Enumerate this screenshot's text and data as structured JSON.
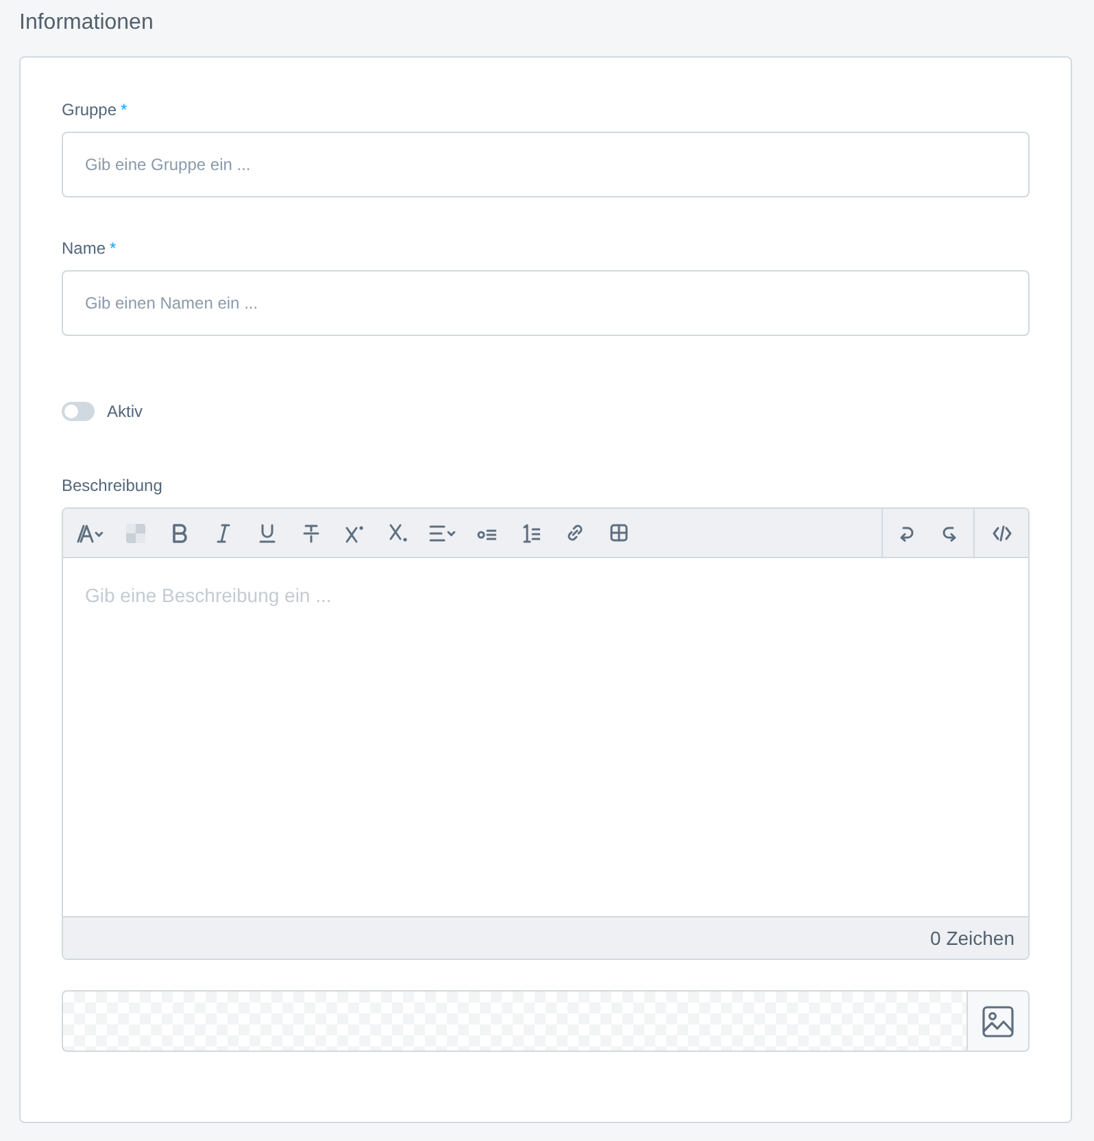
{
  "section": {
    "title": "Informationen"
  },
  "fields": [
    {
      "kind": "text",
      "label": "Gruppe",
      "required_mark": "*",
      "placeholder": "Gib eine Gruppe ein ..."
    },
    {
      "kind": "text",
      "label": "Name",
      "required_mark": "*",
      "placeholder": "Gib einen Namen ein ..."
    }
  ],
  "toggle": {
    "label": "Aktiv",
    "on": false
  },
  "editor": {
    "label": "Beschreibung",
    "toolbar_groups": [
      [
        {
          "kind": "font-size"
        },
        {
          "kind": "color"
        },
        {
          "kind": "bold"
        },
        {
          "kind": "italic"
        },
        {
          "kind": "underline"
        },
        {
          "kind": "strikethrough"
        },
        {
          "kind": "superscript"
        },
        {
          "kind": "subscript"
        },
        {
          "kind": "align"
        },
        {
          "kind": "bullet-list"
        },
        {
          "kind": "numbered-list"
        },
        {
          "kind": "link"
        },
        {
          "kind": "table"
        }
      ],
      [
        {
          "kind": "undo"
        },
        {
          "kind": "redo"
        }
      ],
      [
        {
          "kind": "code-view"
        }
      ]
    ],
    "placeholder": "Gib eine Beschreibung ein ...",
    "counter": "0 Zeichen"
  },
  "image_field": {
    "kind": "image-upload"
  }
}
